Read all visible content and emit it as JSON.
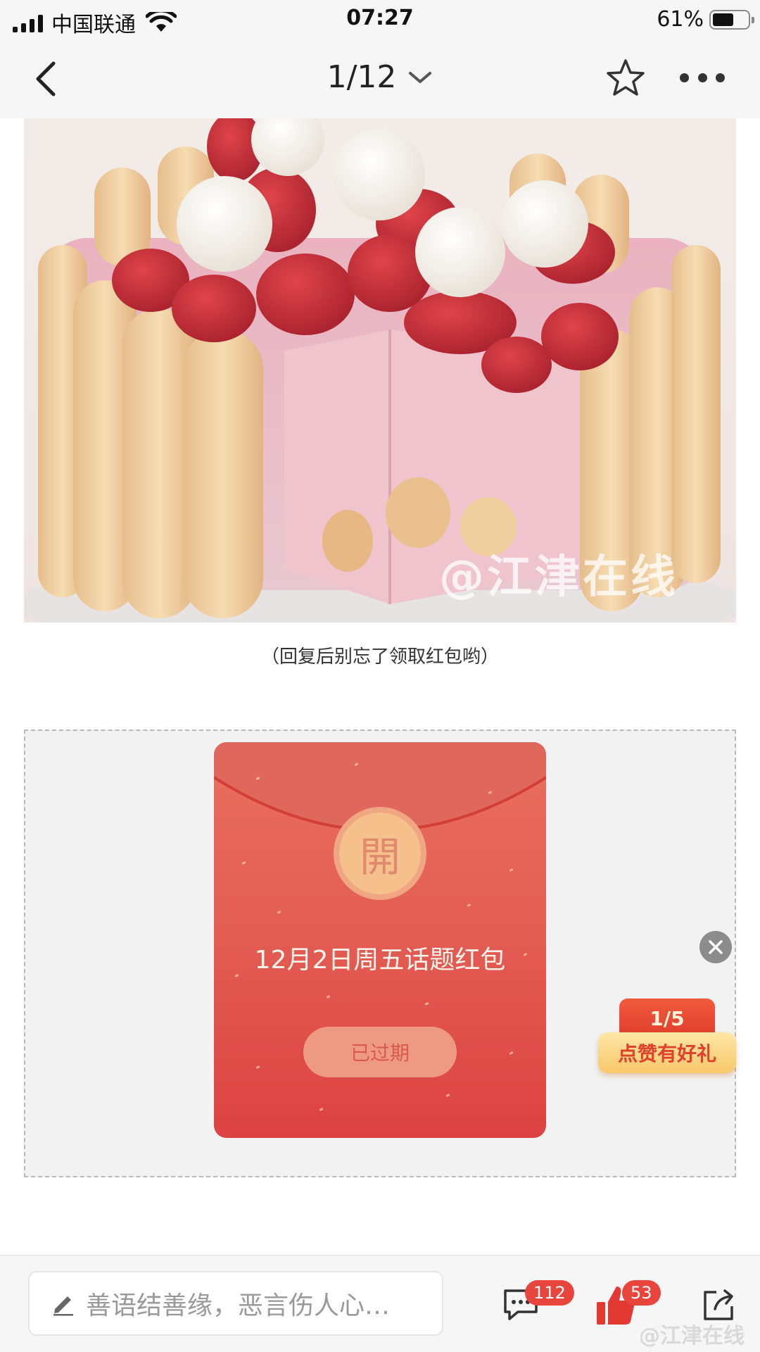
{
  "status_bar": {
    "carrier": "中国联通",
    "time": "07:27",
    "battery_percent": "61%",
    "battery_level": 0.61
  },
  "nav": {
    "title": "1/12",
    "back_icon": "chevron-left-icon",
    "dropdown_icon": "chevron-down-icon",
    "star_icon": "star-outline-icon",
    "more_icon": "more-horizontal-icon"
  },
  "post": {
    "image_watermark": "@江津在线",
    "caption": "（回复后别忘了领取红包哟）"
  },
  "red_packet": {
    "open_label": "開",
    "title": "12月2日周五话题红包",
    "status_button": "已过期"
  },
  "like_gift": {
    "progress": "1/5",
    "label": "点赞有好礼"
  },
  "bottom_bar": {
    "comment_placeholder": "善语结善缘，恶言伤人心…",
    "comment_count": "112",
    "like_count": "53",
    "watermark": "@江津在线"
  },
  "colors": {
    "packet_red": "#e25a51",
    "badge_red": "#e8453c",
    "gold": "#f5c08c"
  }
}
